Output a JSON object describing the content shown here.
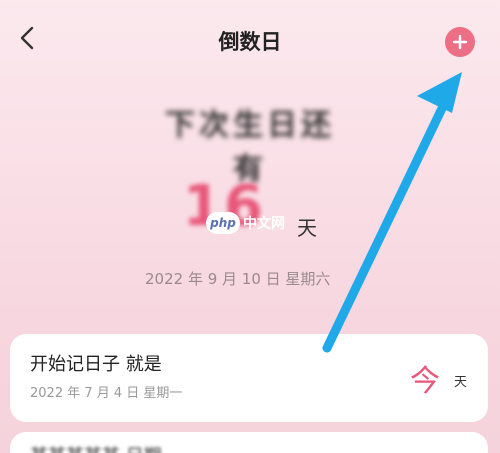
{
  "header": {
    "title": "倒数日",
    "back_icon": "chevron-left-icon",
    "add_icon": "plus-icon",
    "accent_color": "#ec6f86"
  },
  "countdown": {
    "event_title": "下次生日还有",
    "days": "16",
    "unit": "天",
    "target_date": "2022 年 9 月 10 日  星期六"
  },
  "watermark": {
    "logo": "php",
    "text": "中文网"
  },
  "cards": [
    {
      "title": "开始记日子 就是",
      "date": "2022 年 7 月 4 日  星期一",
      "value": "今",
      "unit": "天"
    },
    {
      "title": "某某某某某 日期"
    }
  ],
  "annotation": {
    "arrow_color": "#1fa9e8"
  }
}
